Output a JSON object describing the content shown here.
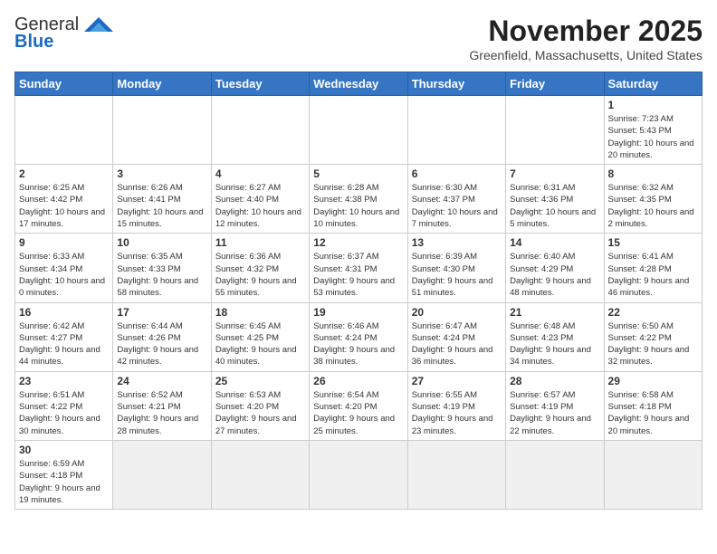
{
  "header": {
    "logo_general": "General",
    "logo_blue": "Blue",
    "month_title": "November 2025",
    "location": "Greenfield, Massachusetts, United States"
  },
  "weekdays": [
    "Sunday",
    "Monday",
    "Tuesday",
    "Wednesday",
    "Thursday",
    "Friday",
    "Saturday"
  ],
  "weeks": [
    [
      {
        "day": "",
        "info": ""
      },
      {
        "day": "",
        "info": ""
      },
      {
        "day": "",
        "info": ""
      },
      {
        "day": "",
        "info": ""
      },
      {
        "day": "",
        "info": ""
      },
      {
        "day": "",
        "info": ""
      },
      {
        "day": "1",
        "info": "Sunrise: 7:23 AM\nSunset: 5:43 PM\nDaylight: 10 hours and 20 minutes."
      }
    ],
    [
      {
        "day": "2",
        "info": "Sunrise: 6:25 AM\nSunset: 4:42 PM\nDaylight: 10 hours and 17 minutes."
      },
      {
        "day": "3",
        "info": "Sunrise: 6:26 AM\nSunset: 4:41 PM\nDaylight: 10 hours and 15 minutes."
      },
      {
        "day": "4",
        "info": "Sunrise: 6:27 AM\nSunset: 4:40 PM\nDaylight: 10 hours and 12 minutes."
      },
      {
        "day": "5",
        "info": "Sunrise: 6:28 AM\nSunset: 4:38 PM\nDaylight: 10 hours and 10 minutes."
      },
      {
        "day": "6",
        "info": "Sunrise: 6:30 AM\nSunset: 4:37 PM\nDaylight: 10 hours and 7 minutes."
      },
      {
        "day": "7",
        "info": "Sunrise: 6:31 AM\nSunset: 4:36 PM\nDaylight: 10 hours and 5 minutes."
      },
      {
        "day": "8",
        "info": "Sunrise: 6:32 AM\nSunset: 4:35 PM\nDaylight: 10 hours and 2 minutes."
      }
    ],
    [
      {
        "day": "9",
        "info": "Sunrise: 6:33 AM\nSunset: 4:34 PM\nDaylight: 10 hours and 0 minutes."
      },
      {
        "day": "10",
        "info": "Sunrise: 6:35 AM\nSunset: 4:33 PM\nDaylight: 9 hours and 58 minutes."
      },
      {
        "day": "11",
        "info": "Sunrise: 6:36 AM\nSunset: 4:32 PM\nDaylight: 9 hours and 55 minutes."
      },
      {
        "day": "12",
        "info": "Sunrise: 6:37 AM\nSunset: 4:31 PM\nDaylight: 9 hours and 53 minutes."
      },
      {
        "day": "13",
        "info": "Sunrise: 6:39 AM\nSunset: 4:30 PM\nDaylight: 9 hours and 51 minutes."
      },
      {
        "day": "14",
        "info": "Sunrise: 6:40 AM\nSunset: 4:29 PM\nDaylight: 9 hours and 48 minutes."
      },
      {
        "day": "15",
        "info": "Sunrise: 6:41 AM\nSunset: 4:28 PM\nDaylight: 9 hours and 46 minutes."
      }
    ],
    [
      {
        "day": "16",
        "info": "Sunrise: 6:42 AM\nSunset: 4:27 PM\nDaylight: 9 hours and 44 minutes."
      },
      {
        "day": "17",
        "info": "Sunrise: 6:44 AM\nSunset: 4:26 PM\nDaylight: 9 hours and 42 minutes."
      },
      {
        "day": "18",
        "info": "Sunrise: 6:45 AM\nSunset: 4:25 PM\nDaylight: 9 hours and 40 minutes."
      },
      {
        "day": "19",
        "info": "Sunrise: 6:46 AM\nSunset: 4:24 PM\nDaylight: 9 hours and 38 minutes."
      },
      {
        "day": "20",
        "info": "Sunrise: 6:47 AM\nSunset: 4:24 PM\nDaylight: 9 hours and 36 minutes."
      },
      {
        "day": "21",
        "info": "Sunrise: 6:48 AM\nSunset: 4:23 PM\nDaylight: 9 hours and 34 minutes."
      },
      {
        "day": "22",
        "info": "Sunrise: 6:50 AM\nSunset: 4:22 PM\nDaylight: 9 hours and 32 minutes."
      }
    ],
    [
      {
        "day": "23",
        "info": "Sunrise: 6:51 AM\nSunset: 4:22 PM\nDaylight: 9 hours and 30 minutes."
      },
      {
        "day": "24",
        "info": "Sunrise: 6:52 AM\nSunset: 4:21 PM\nDaylight: 9 hours and 28 minutes."
      },
      {
        "day": "25",
        "info": "Sunrise: 6:53 AM\nSunset: 4:20 PM\nDaylight: 9 hours and 27 minutes."
      },
      {
        "day": "26",
        "info": "Sunrise: 6:54 AM\nSunset: 4:20 PM\nDaylight: 9 hours and 25 minutes."
      },
      {
        "day": "27",
        "info": "Sunrise: 6:55 AM\nSunset: 4:19 PM\nDaylight: 9 hours and 23 minutes."
      },
      {
        "day": "28",
        "info": "Sunrise: 6:57 AM\nSunset: 4:19 PM\nDaylight: 9 hours and 22 minutes."
      },
      {
        "day": "29",
        "info": "Sunrise: 6:58 AM\nSunset: 4:18 PM\nDaylight: 9 hours and 20 minutes."
      }
    ],
    [
      {
        "day": "30",
        "info": "Sunrise: 6:59 AM\nSunset: 4:18 PM\nDaylight: 9 hours and 19 minutes."
      },
      {
        "day": "",
        "info": ""
      },
      {
        "day": "",
        "info": ""
      },
      {
        "day": "",
        "info": ""
      },
      {
        "day": "",
        "info": ""
      },
      {
        "day": "",
        "info": ""
      },
      {
        "day": "",
        "info": ""
      }
    ]
  ]
}
